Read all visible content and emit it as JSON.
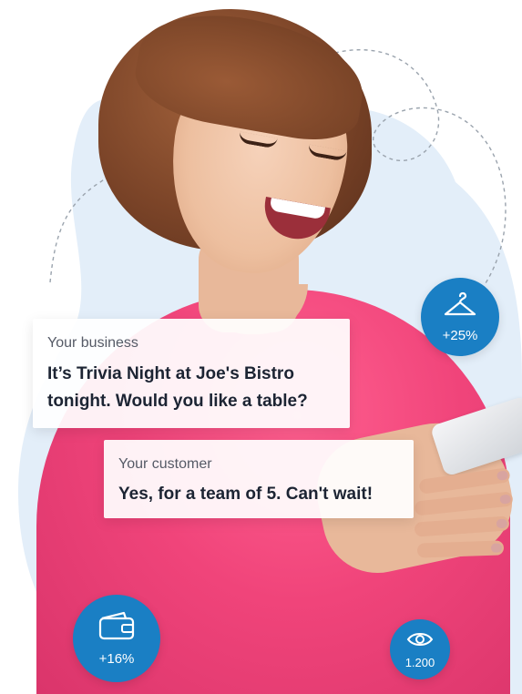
{
  "conversation": {
    "business": {
      "label": "Your business",
      "message_line1": "It’s Trivia Night at Joe's Bistro",
      "message_line2": "tonight. Would you like a table?"
    },
    "customer": {
      "label": "Your customer",
      "message": "Yes, for a team of 5. Can't wait!"
    }
  },
  "badges": [
    {
      "icon": "hanger-icon",
      "value": "+25%"
    },
    {
      "icon": "wallet-icon",
      "value": "+16%"
    },
    {
      "icon": "eye-icon",
      "value": "1.200"
    }
  ],
  "colors": {
    "badge": "#1a7fc4",
    "blob": "#e3eef9",
    "sweater": "#f0447a",
    "text_dark": "#1c2433",
    "text_muted": "#555a66"
  }
}
